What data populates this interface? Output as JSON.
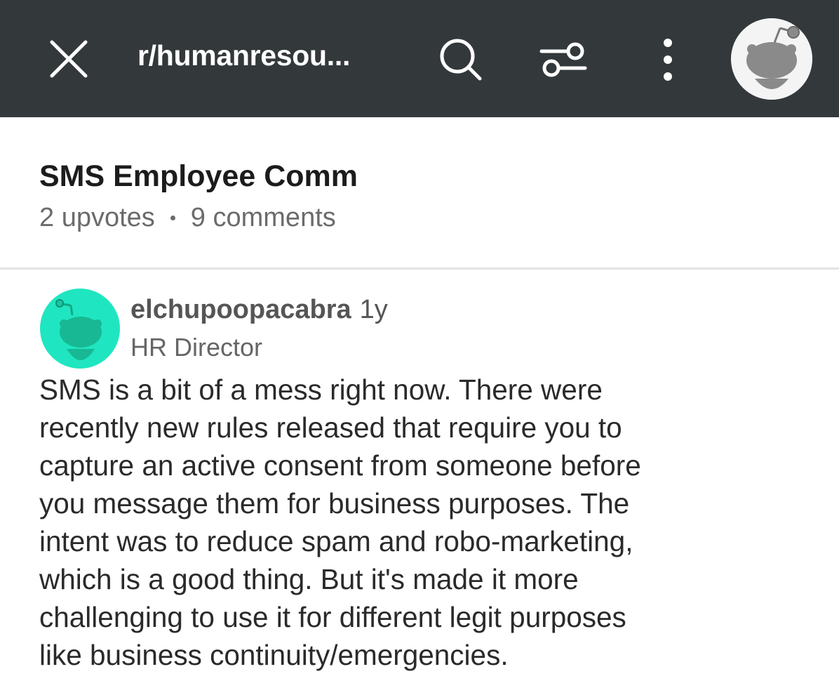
{
  "header": {
    "subreddit": "r/humanresou...",
    "icons": {
      "close": "close-icon",
      "search": "search-icon",
      "filter": "sort-filter-icon",
      "more": "more-vertical-icon",
      "avatar": "user-avatar"
    },
    "background_color": "#33383b"
  },
  "post": {
    "title": "SMS Employee Comm",
    "upvotes": "2 upvotes",
    "comments": "9 comments"
  },
  "comment": {
    "author": "elchupoopacabra",
    "age": "1y",
    "flair": "HR Director",
    "avatar_color": "#1fe6c0",
    "body_lines": [
      "SMS is a bit of a mess right now. There were",
      "recently new rules released that require you to",
      "capture an active consent from someone before",
      "you message them for business purposes. The",
      "intent was to reduce spam and robo-marketing,",
      "which is a good thing. But it's made it more",
      "challenging to use it for different legit purposes",
      "like business continuity/emergencies."
    ]
  }
}
